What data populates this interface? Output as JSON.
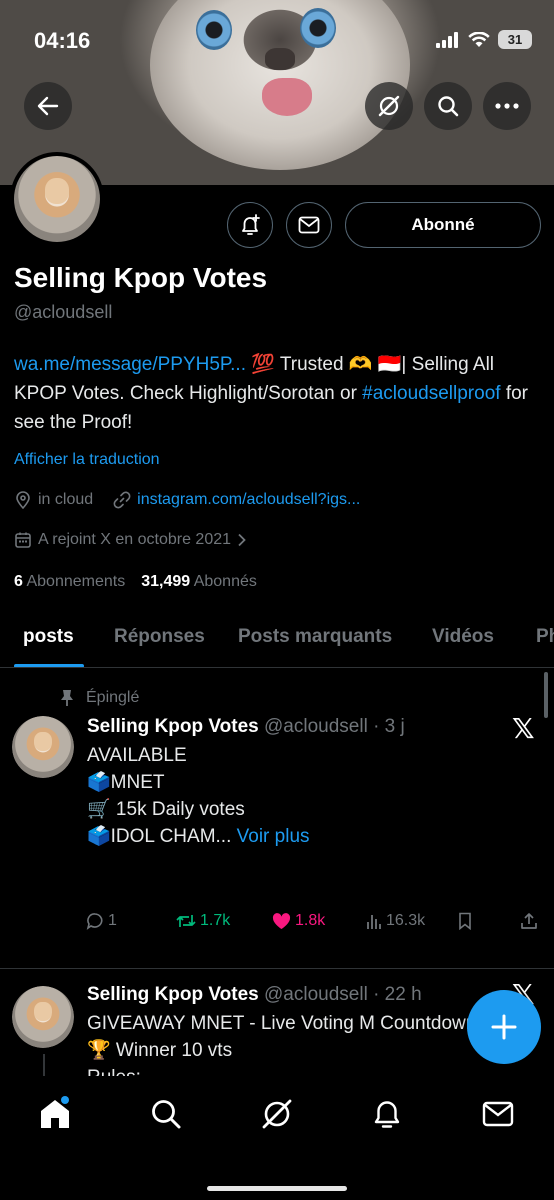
{
  "status": {
    "time": "04:16",
    "battery": "31"
  },
  "profile": {
    "name": "Selling Kpop Votes",
    "handle": "@acloudsell",
    "follow_label": "Abonné",
    "bio": {
      "link": "wa.me/message/PPYH5P...",
      "text1": " 💯 Trusted 🫶 🇮🇩| Selling All KPOP Votes. Check Highlight/Sorotan or ",
      "hashtag": "#acloudsellproof",
      "text2": " for see the Proof!"
    },
    "translate_label": "Afficher la traduction",
    "location": "in cloud",
    "website": "instagram.com/acloudsell?igs...",
    "joined": "A rejoint X en octobre 2021",
    "following_count": "6",
    "following_label": "Abonnements",
    "followers_count": "31,499",
    "followers_label": "Abonnés"
  },
  "tabs": [
    "posts",
    "Réponses",
    "Posts marquants",
    "Vidéos",
    "Ph"
  ],
  "posts": [
    {
      "pinned_label": "Épinglé",
      "author": "Selling Kpop Votes",
      "meta": "@acloudsell · 3 j",
      "lines": [
        "AVAILABLE",
        "🗳️MNET",
        "🛒 15k Daily votes",
        "🗳️IDOL CHAM..."
      ],
      "more_label": "Voir plus",
      "replies": "1",
      "reposts": "1.7k",
      "likes": "1.8k",
      "views": "16.3k"
    },
    {
      "author": "Selling Kpop Votes",
      "meta": "@acloudsell · 22 h",
      "lines": [
        "GIVEAWAY MNET - Live Voting M Countdown",
        "🏆 Winner 10 vts",
        "Rules:"
      ]
    }
  ],
  "colors": {
    "accent": "#1d9bf0",
    "like": "#f91880",
    "repost": "#00ba7c"
  },
  "icons": [
    "back-arrow-icon",
    "grok-icon",
    "search-icon",
    "more-icon",
    "bell-plus-icon",
    "mail-icon",
    "location-icon",
    "link-icon",
    "calendar-icon",
    "pin-icon",
    "x-logo-icon",
    "reply-icon",
    "repost-icon",
    "heart-icon",
    "views-icon",
    "bookmark-icon",
    "share-icon",
    "plus-icon",
    "home-icon",
    "notifications-icon"
  ]
}
